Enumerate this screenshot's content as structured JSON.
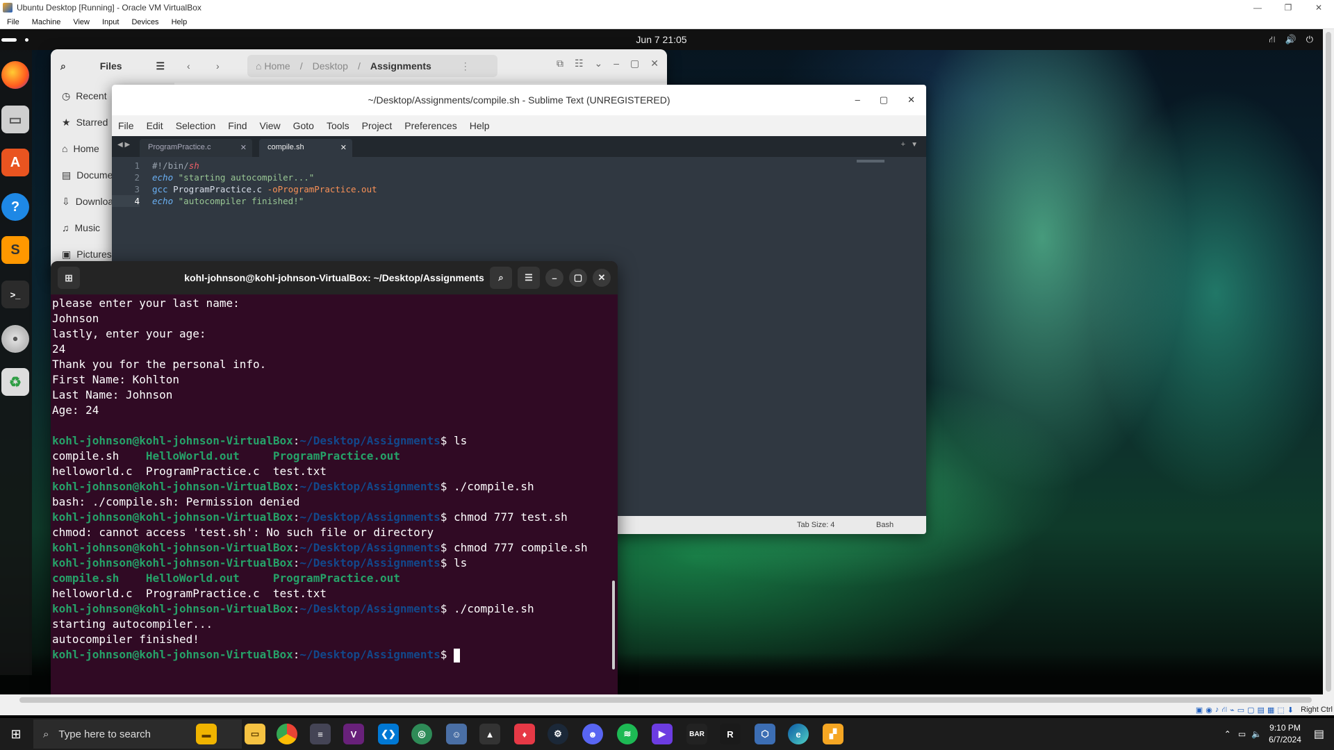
{
  "host": {
    "title": "Ubuntu Desktop [Running] - Oracle VM VirtualBox",
    "menu": [
      "File",
      "Machine",
      "View",
      "Input",
      "Devices",
      "Help"
    ],
    "status_right": "Right Ctrl"
  },
  "gnome": {
    "clock": "Jun 7  21:05"
  },
  "files": {
    "title": "Files",
    "sidebar": [
      "Recent",
      "Starred",
      "Home",
      "Documents",
      "Downloads",
      "Music",
      "Pictures"
    ],
    "path": [
      "Home",
      "Desktop",
      "Assignments"
    ]
  },
  "sublime": {
    "title": "~/Desktop/Assignments/compile.sh - Sublime Text (UNREGISTERED)",
    "menu": [
      "File",
      "Edit",
      "Selection",
      "Find",
      "View",
      "Goto",
      "Tools",
      "Project",
      "Preferences",
      "Help"
    ],
    "tabs": [
      "ProgramPractice.c",
      "compile.sh"
    ],
    "lines": [
      {
        "num": "1",
        "text": "#!/bin/sh"
      },
      {
        "num": "2",
        "text": "echo \"starting autocompiler...\""
      },
      {
        "num": "3",
        "text": "gcc ProgramPractice.c -oProgramPractice.out"
      },
      {
        "num": "4",
        "text": "echo \"autocompiler finished!\""
      }
    ],
    "status": {
      "tab_size": "Tab Size: 4",
      "syntax": "Bash"
    }
  },
  "terminal": {
    "title": "kohl-johnson@kohl-johnson-VirtualBox: ~/Desktop/Assignments",
    "user": "kohl-johnson@kohl-johnson-VirtualBox",
    "path": "~/Desktop/Assignments",
    "lines": [
      "please enter your last name:",
      "Johnson",
      "lastly, enter your age:",
      "24",
      "Thank you for the personal info.",
      "First Name: Kohlton",
      "Last Name: Johnson",
      "Age: 24",
      "",
      "ls",
      "bash: ./compile.sh: Permission denied",
      "chmod 777 test.sh",
      "chmod: cannot access 'test.sh': No such file or directory",
      "chmod 777 compile.sh",
      "./compile.sh",
      "starting autocompiler...",
      "autocompiler finished!"
    ],
    "ls1": [
      "compile.sh",
      "HelloWorld.out",
      "ProgramPractice.out",
      "helloworld.c",
      "ProgramPractice.c",
      "test.txt"
    ]
  },
  "taskbar": {
    "search_placeholder": "Type here to search",
    "time": "9:10 PM",
    "date": "6/7/2024"
  }
}
